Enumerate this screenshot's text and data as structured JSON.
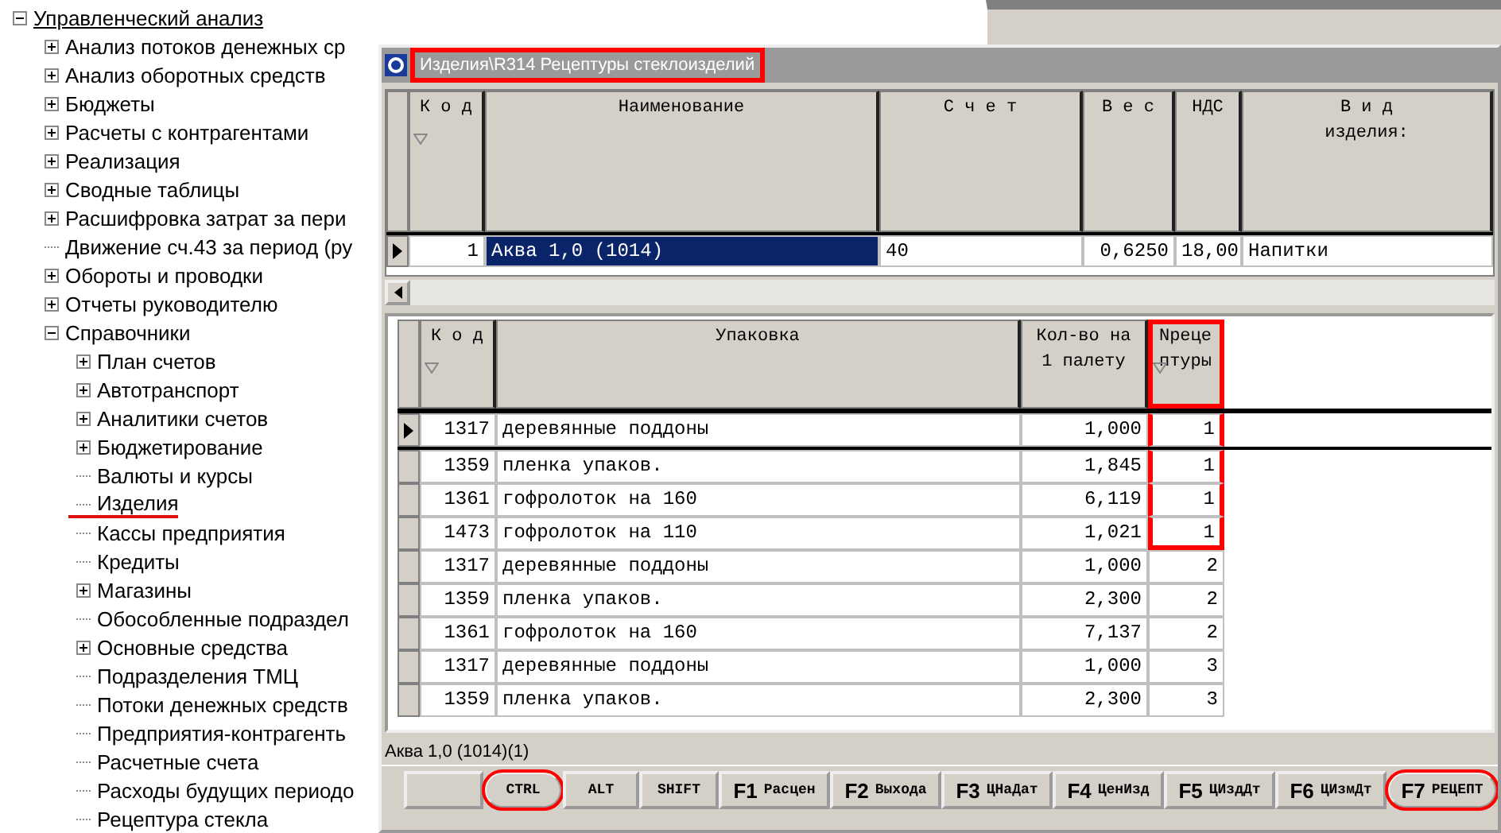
{
  "tree": [
    {
      "label": "Управленческий анализ",
      "expanded": true,
      "children": [
        {
          "label": "Анализ потоков денежных ср",
          "expanded": false
        },
        {
          "label": "Анализ оборотных средств",
          "expanded": false
        },
        {
          "label": "Бюджеты",
          "expanded": false
        },
        {
          "label": "Расчеты с контрагентами",
          "expanded": false
        },
        {
          "label": "Реализация",
          "expanded": false
        },
        {
          "label": "Сводные таблицы",
          "expanded": false
        },
        {
          "label": "Расшифровка затрат за пери",
          "expanded": false
        },
        {
          "label": "Движение сч.43 за период (ру"
        },
        {
          "label": "Обороты и проводки",
          "expanded": false
        },
        {
          "label": "Отчеты руководителю",
          "expanded": false
        },
        {
          "label": "Справочники",
          "expanded": true,
          "children": [
            {
              "label": "План счетов",
              "expanded": false
            },
            {
              "label": "Автотранспорт",
              "expanded": false
            },
            {
              "label": "Аналитики счетов",
              "expanded": false
            },
            {
              "label": "Бюджетирование",
              "expanded": false
            },
            {
              "label": "Валюты и курсы"
            },
            {
              "label": "Изделия",
              "marked": true
            },
            {
              "label": "Кассы предприятия"
            },
            {
              "label": "Кредиты"
            },
            {
              "label": "Магазины",
              "expanded": false
            },
            {
              "label": "Обособленные подраздел"
            },
            {
              "label": "Основные средства",
              "expanded": false
            },
            {
              "label": "Подразделения ТМЦ"
            },
            {
              "label": "Потоки денежных средств"
            },
            {
              "label": "Предприятия-контрагенть"
            },
            {
              "label": "Расчетные счета"
            },
            {
              "label": "Расходы будущих периодо"
            },
            {
              "label": "Рецептура стекла"
            }
          ]
        }
      ]
    }
  ],
  "window": {
    "title": "Изделия\\R314 Рецептуры стеклоизделий",
    "title_marked": true
  },
  "upper_grid": {
    "columns": [
      {
        "label": "К о д",
        "sortable": true
      },
      {
        "label": "Наименование"
      },
      {
        "label": "С ч е т"
      },
      {
        "label": "В е с"
      },
      {
        "label": "НДС"
      },
      {
        "label": "В и д\nизделия:"
      }
    ],
    "rows": [
      {
        "selected": true,
        "cells": [
          "1",
          "Аква 1,0 (1014)",
          "40",
          "0,6250",
          "18,00",
          "Напитки"
        ]
      }
    ]
  },
  "lower_grid": {
    "columns": [
      {
        "label": "К о д",
        "sortable": true,
        "marked": false
      },
      {
        "label": "Упаковка",
        "marked": false
      },
      {
        "label": "Кол-во на\n1 палету",
        "marked": false
      },
      {
        "label": "Nреце\nптуры",
        "sortable": true,
        "marked": true
      }
    ],
    "rows": [
      {
        "selected": true,
        "marked": true,
        "cells": [
          "1317",
          "деревянные поддоны",
          "1,000",
          "1"
        ]
      },
      {
        "selected": false,
        "marked": true,
        "cells": [
          "1359",
          "пленка упаков.",
          "1,845",
          "1"
        ]
      },
      {
        "selected": false,
        "marked": true,
        "cells": [
          "1361",
          "гофролоток на 160",
          "6,119",
          "1"
        ]
      },
      {
        "selected": false,
        "marked": true,
        "cells": [
          "1473",
          "гофролоток на 110",
          "1,021",
          "1"
        ]
      },
      {
        "selected": false,
        "marked": false,
        "cells": [
          "1317",
          "деревянные поддоны",
          "1,000",
          "2"
        ]
      },
      {
        "selected": false,
        "marked": false,
        "cells": [
          "1359",
          "пленка упаков.",
          "2,300",
          "2"
        ]
      },
      {
        "selected": false,
        "marked": false,
        "cells": [
          "1361",
          "гофролоток на 160",
          "7,137",
          "2"
        ]
      },
      {
        "selected": false,
        "marked": false,
        "cells": [
          "1317",
          "деревянные поддоны",
          "1,000",
          "3"
        ]
      },
      {
        "selected": false,
        "marked": false,
        "cells": [
          "1359",
          "пленка упаков.",
          "2,300",
          "3"
        ]
      }
    ]
  },
  "status": "Аква 1,0 (1014)(1)",
  "keys": [
    {
      "kind": "modifier",
      "label": "CTRL",
      "circled": true
    },
    {
      "kind": "modifier",
      "label": "ALT",
      "circled": false
    },
    {
      "kind": "modifier",
      "label": "SHIFT",
      "circled": false
    },
    {
      "kind": "function",
      "key": "F1",
      "label": "Расцен",
      "circled": false
    },
    {
      "kind": "function",
      "key": "F2",
      "label": "Выхода",
      "circled": false
    },
    {
      "kind": "function",
      "key": "F3",
      "label": "ЦНаДат",
      "circled": false
    },
    {
      "kind": "function",
      "key": "F4",
      "label": "ЦенИзд",
      "circled": false
    },
    {
      "kind": "function",
      "key": "F5",
      "label": "ЦИздДт",
      "circled": false
    },
    {
      "kind": "function",
      "key": "F6",
      "label": "ЦИзмДт",
      "circled": false
    },
    {
      "kind": "function",
      "key": "F7",
      "label": "РЕЦЕПТ",
      "circled": true
    }
  ]
}
